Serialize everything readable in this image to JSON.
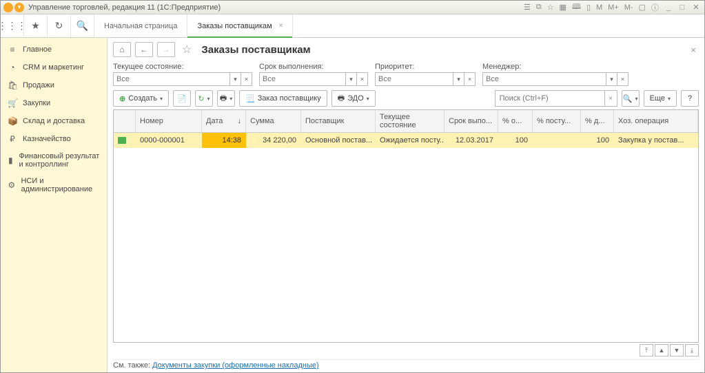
{
  "titlebar": {
    "title": "Управление торговлей, редакция 11 (1С:Предприятие)",
    "m_labels": [
      "M",
      "M+",
      "M-"
    ]
  },
  "tabs": {
    "start": "Начальная страница",
    "active": "Заказы поставщикам"
  },
  "sidebar": [
    {
      "icon": "≡",
      "label": "Главное"
    },
    {
      "icon": "◔",
      "label": "CRM и маркетинг"
    },
    {
      "icon": "🛍",
      "label": "Продажи"
    },
    {
      "icon": "🛒",
      "label": "Закупки"
    },
    {
      "icon": "📦",
      "label": "Склад и доставка"
    },
    {
      "icon": "₽",
      "label": "Казначейство"
    },
    {
      "icon": "▮",
      "label": "Финансовый результат и контроллинг"
    },
    {
      "icon": "⚙",
      "label": "НСИ и администрирование"
    }
  ],
  "page": {
    "title": "Заказы поставщикам"
  },
  "filters": {
    "state": {
      "label": "Текущее состояние:",
      "placeholder": "Все"
    },
    "due": {
      "label": "Срок выполнения:",
      "placeholder": "Все"
    },
    "prio": {
      "label": "Приоритет:",
      "placeholder": "Все"
    },
    "mgr": {
      "label": "Менеджер:",
      "placeholder": "Все"
    }
  },
  "toolbar": {
    "create": "Создать",
    "order": "Заказ поставщику",
    "edo": "ЭДО",
    "search_placeholder": "Поиск (Ctrl+F)",
    "more": "Еще"
  },
  "grid": {
    "headers": [
      "",
      "Номер",
      "Дата",
      "Сумма",
      "Поставщик",
      "Текущее состояние",
      "Срок выпо...",
      "% о...",
      "% посту...",
      "% д...",
      "Хоз. операция"
    ],
    "sort_icon": "↓",
    "rows": [
      {
        "num": "0000-000001",
        "date": "14:38",
        "sum": "34 220,00",
        "supplier": "Основной постав...",
        "state": "Ожидается посту...",
        "due": "12.03.2017",
        "pct_o": "100",
        "pct_post": "",
        "pct_d": "100",
        "op": "Закупка у постав..."
      }
    ]
  },
  "footer": {
    "prefix": "См. также: ",
    "link": "Документы закупки (оформленные накладные)"
  }
}
